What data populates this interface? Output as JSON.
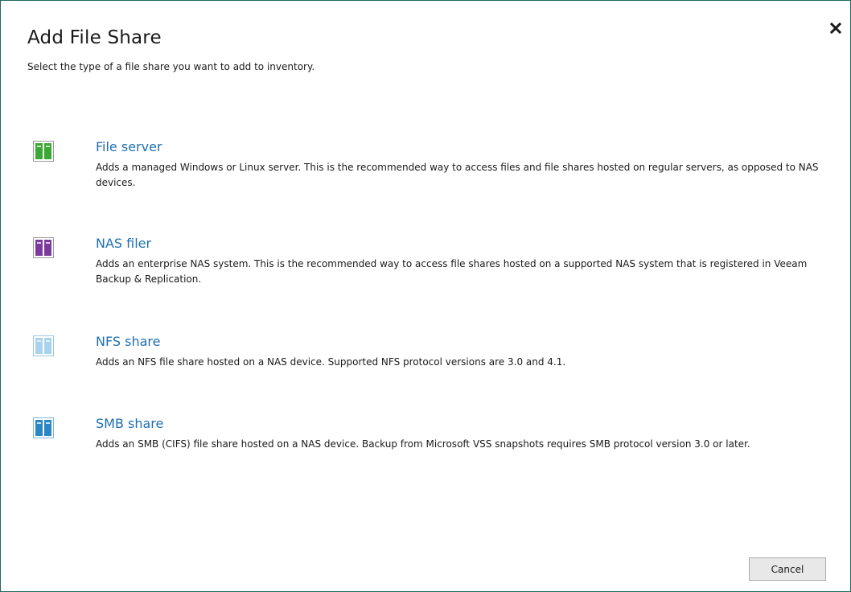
{
  "dialog": {
    "title": "Add File Share",
    "subtitle": "Select the type of a file share you want to add to inventory."
  },
  "options": [
    {
      "title": "File server",
      "description": "Adds a managed Windows or Linux server. This is the recommended way to access files and file shares hosted on regular servers, as opposed to NAS devices.",
      "icon": "file-server-icon"
    },
    {
      "title": "NAS filer",
      "description": "Adds an enterprise NAS system. This is the recommended way to access file shares hosted on a supported NAS system that is registered in Veeam Backup & Replication.",
      "icon": "nas-filer-icon"
    },
    {
      "title": "NFS share",
      "description": "Adds an NFS file share hosted on a NAS device. Supported NFS protocol versions are 3.0 and 4.1.",
      "icon": "nfs-share-icon"
    },
    {
      "title": "SMB share",
      "description": "Adds an SMB (CIFS) file share hosted on a NAS device. Backup from Microsoft VSS snapshots requires SMB protocol version 3.0 or later.",
      "icon": "smb-share-icon"
    }
  ],
  "footer": {
    "cancel_label": "Cancel"
  },
  "colors": {
    "accent": "#1e6fb3",
    "border": "#1f6b5f",
    "file_server_icon": "#3aa832",
    "nas_filer_icon": "#7d3a9e",
    "nfs_share_icon": "#a9d2ef",
    "smb_share_icon": "#2a86c6"
  }
}
